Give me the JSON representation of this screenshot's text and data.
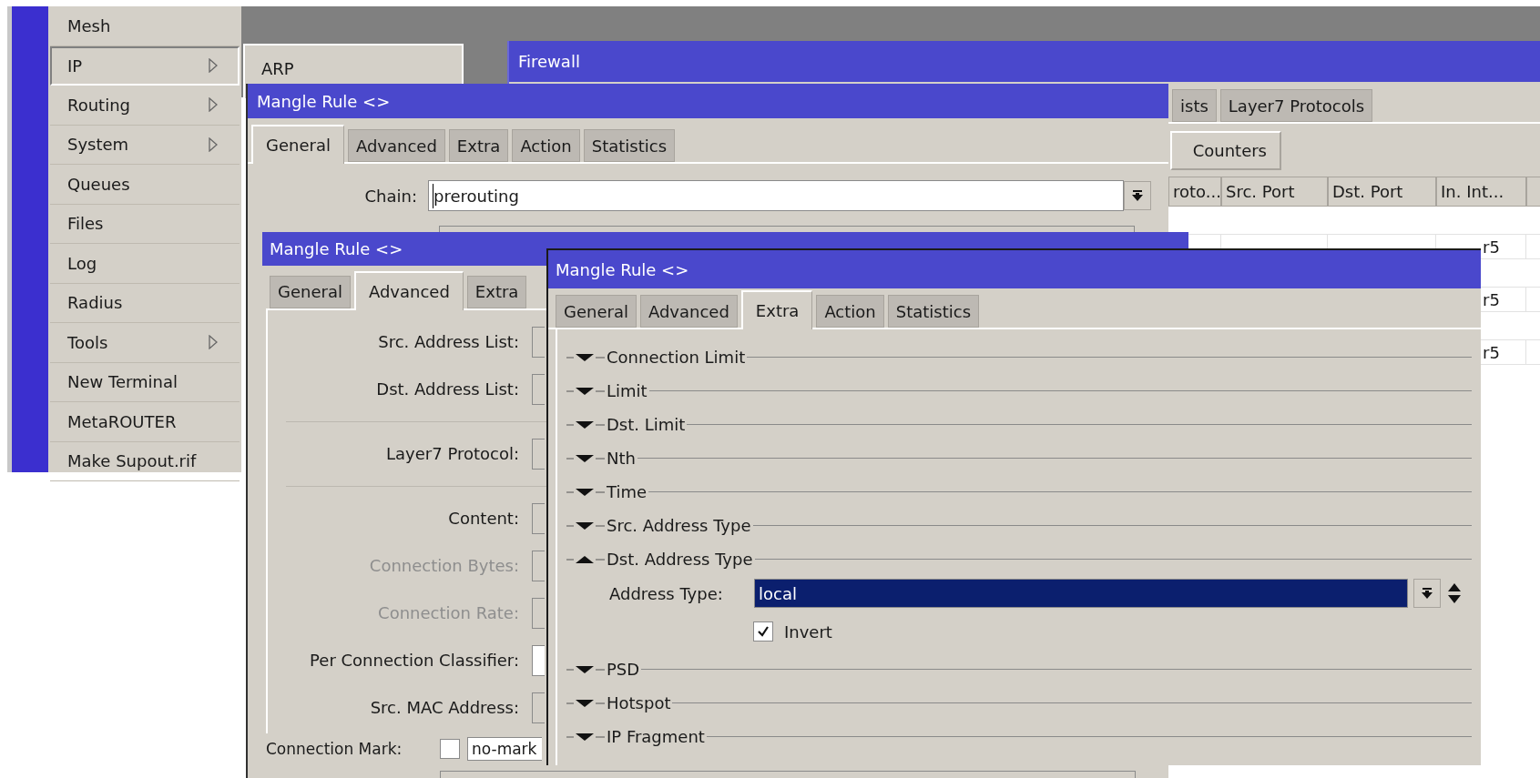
{
  "sidebar": {
    "items": [
      {
        "label": "Mesh",
        "submenu": false,
        "selected": false
      },
      {
        "label": "IP",
        "submenu": true,
        "selected": true
      },
      {
        "label": "Routing",
        "submenu": true,
        "selected": false
      },
      {
        "label": "System",
        "submenu": true,
        "selected": false
      },
      {
        "label": "Queues",
        "submenu": false,
        "selected": false
      },
      {
        "label": "Files",
        "submenu": false,
        "selected": false
      },
      {
        "label": "Log",
        "submenu": false,
        "selected": false
      },
      {
        "label": "Radius",
        "submenu": false,
        "selected": false
      },
      {
        "label": "Tools",
        "submenu": true,
        "selected": false
      },
      {
        "label": "New Terminal",
        "submenu": false,
        "selected": false
      },
      {
        "label": "MetaROUTER",
        "submenu": false,
        "selected": false
      },
      {
        "label": "Make Supout.rif",
        "submenu": false,
        "selected": false
      }
    ]
  },
  "submenu": {
    "items": [
      {
        "label": "ARP"
      }
    ]
  },
  "firewall_window": {
    "title": "Firewall",
    "tabs": [
      {
        "label": "ists",
        "selected": false
      },
      {
        "label": "Layer7 Protocols",
        "selected": false
      }
    ],
    "buttons": [
      "Counters"
    ],
    "table": {
      "columns": [
        "roto...",
        "Src. Port",
        "Dst. Port",
        "In. Int..."
      ],
      "rows": [
        {
          "in_int": "r5"
        },
        {
          "in_int": "r5"
        },
        {
          "in_int": "r5"
        }
      ]
    }
  },
  "mangle_rule_general": {
    "title": "Mangle Rule <>",
    "tabs": [
      {
        "label": "General",
        "selected": true
      },
      {
        "label": "Advanced",
        "selected": false
      },
      {
        "label": "Extra",
        "selected": false
      },
      {
        "label": "Action",
        "selected": false
      },
      {
        "label": "Statistics",
        "selected": false
      }
    ],
    "chain": {
      "label": "Chain:",
      "value": "prerouting"
    }
  },
  "mangle_rule_advanced": {
    "title": "Mangle Rule <>",
    "tabs": [
      {
        "label": "General",
        "selected": false
      },
      {
        "label": "Advanced",
        "selected": true
      },
      {
        "label": "Extra",
        "selected": false
      }
    ],
    "rows": [
      {
        "kind": "combo",
        "label": "Src. Address List:",
        "disabled": false
      },
      {
        "kind": "combo",
        "label": "Dst. Address List:",
        "disabled": false
      },
      {
        "kind": "separator"
      },
      {
        "kind": "combo",
        "label": "Layer7 Protocol:",
        "disabled": false
      },
      {
        "kind": "separator"
      },
      {
        "kind": "combo",
        "label": "Content:",
        "disabled": false
      },
      {
        "kind": "combo",
        "label": "Connection Bytes:",
        "disabled": true
      },
      {
        "kind": "combo",
        "label": "Connection Rate:",
        "disabled": true
      },
      {
        "kind": "input",
        "label": "Per Connection Classifier:",
        "disabled": false
      },
      {
        "kind": "combo",
        "label": "Src. MAC Address:",
        "disabled": false
      }
    ],
    "connection_mark": {
      "label": "Connection Mark:",
      "checked": false,
      "value": "no-mark"
    }
  },
  "mangle_rule_extra": {
    "title": "Mangle Rule <>",
    "tabs": [
      {
        "label": "General",
        "selected": false
      },
      {
        "label": "Advanced",
        "selected": false
      },
      {
        "label": "Extra",
        "selected": true
      },
      {
        "label": "Action",
        "selected": false
      },
      {
        "label": "Statistics",
        "selected": false
      }
    ],
    "sections": [
      {
        "label": "Connection Limit",
        "expanded": false
      },
      {
        "label": "Limit",
        "expanded": false
      },
      {
        "label": "Dst. Limit",
        "expanded": false
      },
      {
        "label": "Nth",
        "expanded": false
      },
      {
        "label": "Time",
        "expanded": false
      },
      {
        "label": "Src. Address Type",
        "expanded": false
      },
      {
        "label": "Dst. Address Type",
        "expanded": true,
        "address_type": {
          "label": "Address Type:",
          "value": "local",
          "selected": true
        },
        "invert": {
          "label": "Invert",
          "checked": true
        }
      },
      {
        "label": "PSD",
        "expanded": false
      },
      {
        "label": "Hotspot",
        "expanded": false
      },
      {
        "label": "IP Fragment",
        "expanded": false
      }
    ]
  }
}
